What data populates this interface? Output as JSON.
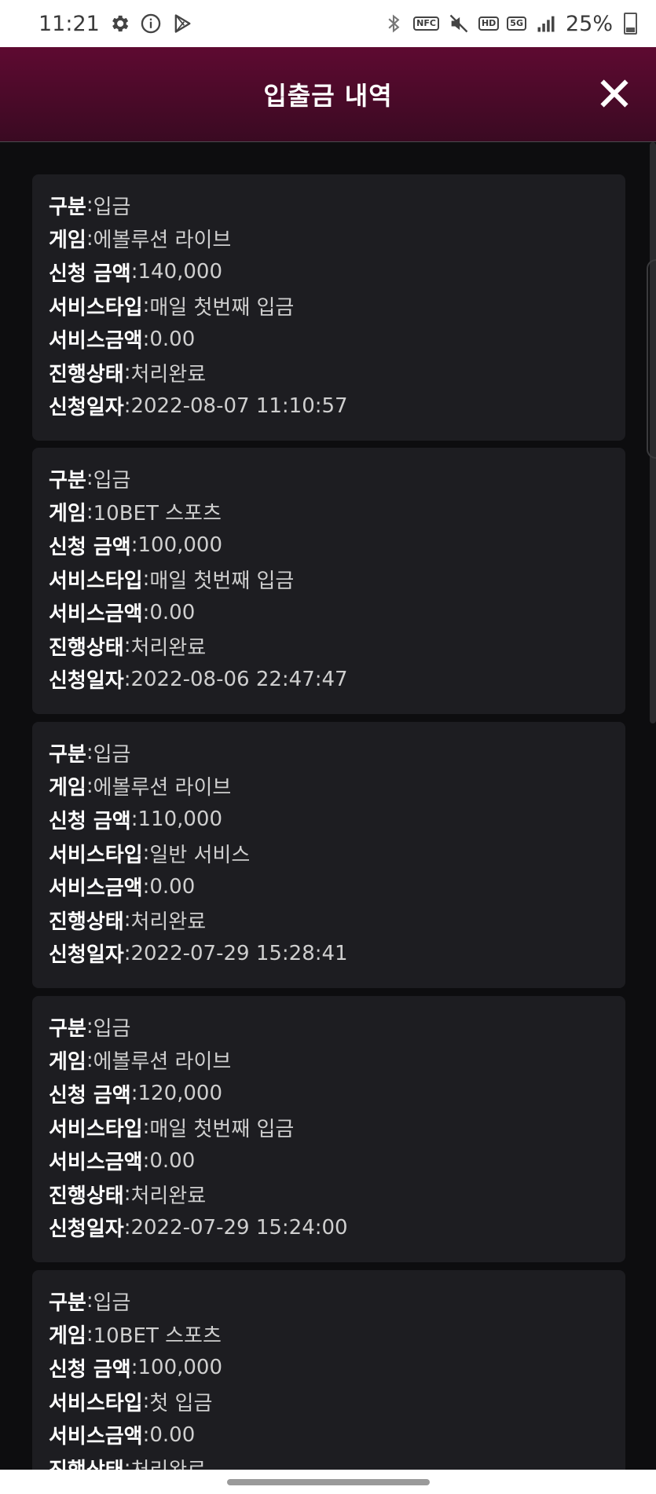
{
  "status_bar": {
    "time": "11:21",
    "left_icons": [
      "gear-icon",
      "info-icon",
      "play-store-icon"
    ],
    "right_icons": [
      "bluetooth-icon",
      "nfc-icon",
      "mute-icon",
      "hd-icon",
      "5g-icon",
      "signal-icon"
    ],
    "nfc_label": "NFC",
    "hd_label": "HD",
    "network_label": "5G",
    "battery": "25%"
  },
  "header": {
    "title": "입출금 내역",
    "close_icon": "close-icon"
  },
  "labels": {
    "type": "구분",
    "game": "게임",
    "amount": "신청 금액",
    "service_type": "서비스타입",
    "service_amount": "서비스금액",
    "status": "진행상태",
    "date": "신청일자",
    "separator": ": "
  },
  "records": [
    {
      "type": "입금",
      "game": "에볼루션 라이브",
      "amount": "140,000",
      "service_type": "매일 첫번째 입금",
      "service_amount": "0.00",
      "status": "처리완료",
      "date": "2022-08-07 11:10:57"
    },
    {
      "type": "입금",
      "game": "10BET 스포츠",
      "amount": "100,000",
      "service_type": "매일 첫번째 입금",
      "service_amount": "0.00",
      "status": "처리완료",
      "date": "2022-08-06 22:47:47"
    },
    {
      "type": "입금",
      "game": "에볼루션 라이브",
      "amount": "110,000",
      "service_type": "일반 서비스",
      "service_amount": "0.00",
      "status": "처리완료",
      "date": "2022-07-29 15:28:41"
    },
    {
      "type": "입금",
      "game": "에볼루션 라이브",
      "amount": "120,000",
      "service_type": "매일 첫번째 입금",
      "service_amount": "0.00",
      "status": "처리완료",
      "date": "2022-07-29 15:24:00"
    },
    {
      "type": "입금",
      "game": "10BET 스포츠",
      "amount": "100,000",
      "service_type": "첫 입금",
      "service_amount": "0.00",
      "status": "처리완료",
      "date": ""
    }
  ],
  "colors": {
    "header_top": "#5e0a31",
    "background": "#0d0d0f",
    "card": "#1d1d21"
  }
}
